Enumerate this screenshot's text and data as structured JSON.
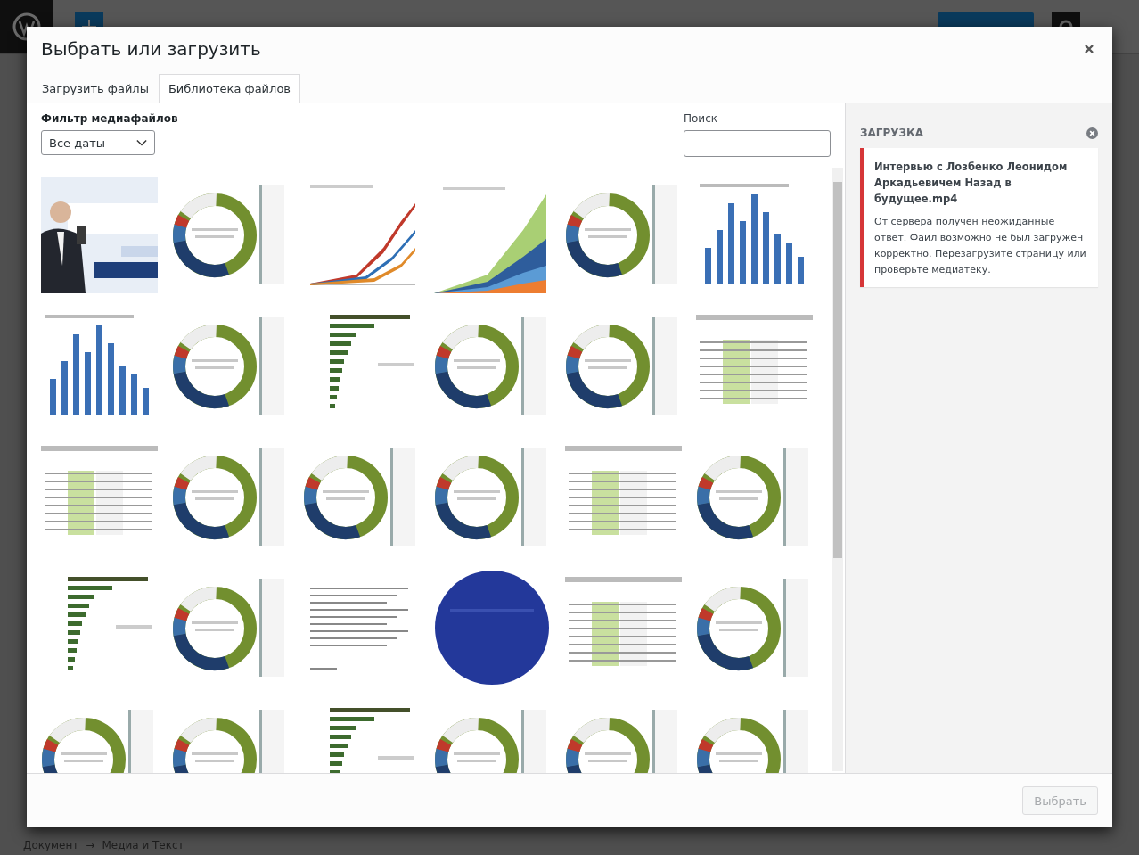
{
  "editor": {
    "breadcrumb": [
      "Документ",
      "→",
      "Медиа и Текст"
    ]
  },
  "modal": {
    "title": "Выбрать или загрузить",
    "tabs": [
      {
        "label": "Загрузить файлы",
        "selected": false
      },
      {
        "label": "Библиотека файлов",
        "selected": true
      }
    ],
    "filter": {
      "label": "Фильтр медиафайлов",
      "value": "Все даты"
    },
    "search": {
      "label": "Поиск"
    },
    "sidebar": {
      "heading": "ЗАГРУЗКА",
      "error": {
        "filename": "Интервью с Лозбенко Леонидом Аркадьевичем Назад в будущее.mp4",
        "message": "От сервера получен неожиданные ответ. Файл возможно не был загружен корректно. Перезагрузите страницу или проверьте медиатеку."
      }
    },
    "footer": {
      "button": {
        "label": "Выбрать",
        "disabled": true
      }
    }
  }
}
